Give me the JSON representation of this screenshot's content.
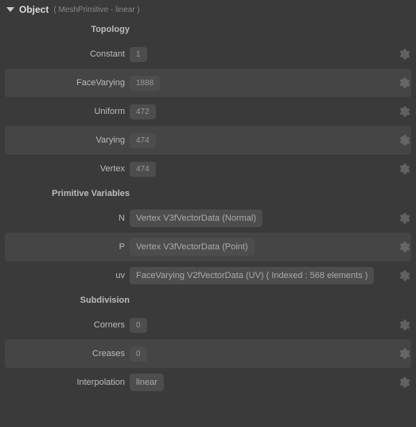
{
  "header": {
    "title": "Object",
    "subtitle": "( MeshPrimitive - linear )"
  },
  "sections": {
    "topology": {
      "title": "Topology",
      "rows": [
        {
          "label": "Constant",
          "value": "1"
        },
        {
          "label": "FaceVarying",
          "value": "1888"
        },
        {
          "label": "Uniform",
          "value": "472"
        },
        {
          "label": "Varying",
          "value": "474"
        },
        {
          "label": "Vertex",
          "value": "474"
        }
      ]
    },
    "primvars": {
      "title": "Primitive Variables",
      "rows": [
        {
          "label": "N",
          "value": "Vertex V3fVectorData (Normal)"
        },
        {
          "label": "P",
          "value": "Vertex V3fVectorData (Point)"
        },
        {
          "label": "uv",
          "value": "FaceVarying V2fVectorData (UV) ( Indexed : 568 elements )"
        }
      ]
    },
    "subdivision": {
      "title": "Subdivision",
      "rows": [
        {
          "label": "Corners",
          "value": "0"
        },
        {
          "label": "Creases",
          "value": "0"
        },
        {
          "label": "Interpolation",
          "value": "linear"
        }
      ]
    }
  }
}
